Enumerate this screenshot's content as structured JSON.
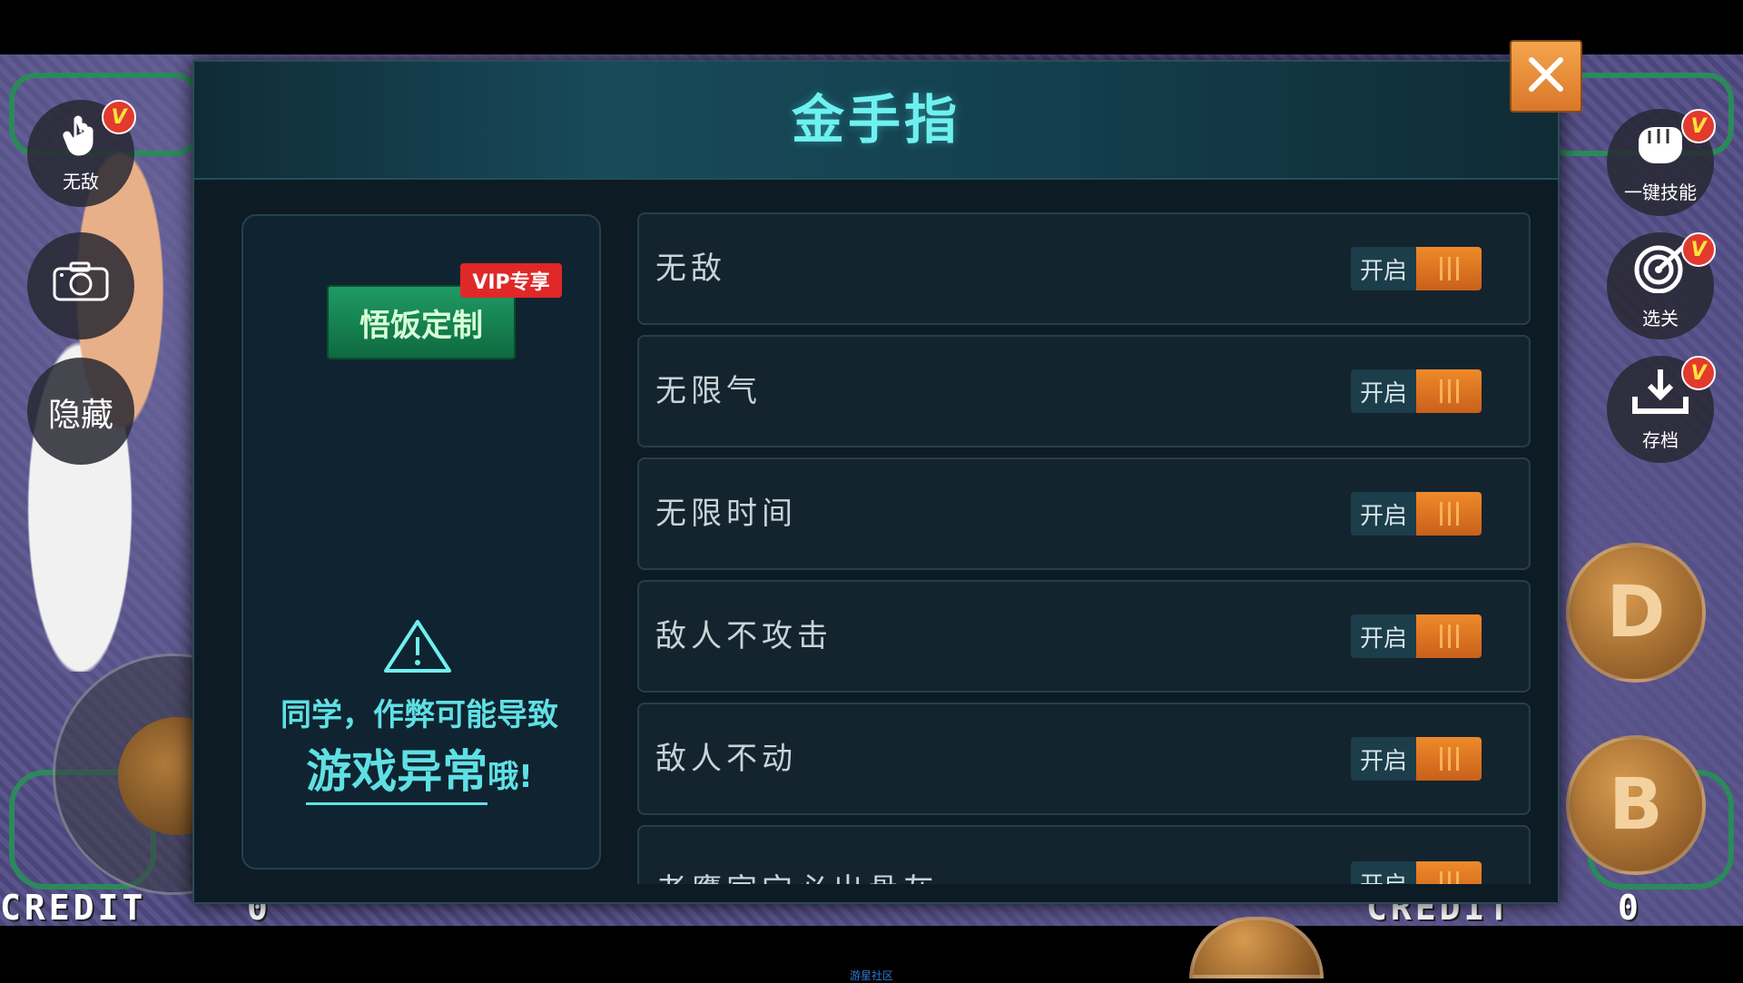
{
  "dialog": {
    "title": "金手指"
  },
  "left_buttons": {
    "invincible": {
      "label": "无敌",
      "icon": "hand-pointer-icon",
      "badge": "V"
    },
    "screenshot": {
      "icon": "camera-icon"
    },
    "hide": {
      "label": "隐藏"
    }
  },
  "right_buttons": {
    "skill": {
      "label": "一键技能",
      "icon": "fist-icon",
      "badge": "V"
    },
    "level": {
      "label": "选关",
      "icon": "target-icon",
      "badge": "V"
    },
    "save": {
      "label": "存档",
      "icon": "download-icon",
      "badge": "V"
    }
  },
  "action_buttons": {
    "d": "D",
    "b": "B"
  },
  "credits": {
    "left_label": "CREDIT",
    "left_value": "0",
    "right_label": "CREDIT",
    "right_value": "0"
  },
  "vip": {
    "button_label": "悟饭定制",
    "badge": "VIP专享"
  },
  "warning": {
    "line1": "同学，作弊可能导致",
    "emphasis": "游戏异常",
    "tail": "哦!"
  },
  "cheats": [
    {
      "name": "无敌",
      "toggle_label": "开启"
    },
    {
      "name": "无限气",
      "toggle_label": "开启"
    },
    {
      "name": "无限时间",
      "toggle_label": "开启"
    },
    {
      "name": "敌人不攻击",
      "toggle_label": "开启"
    },
    {
      "name": "敌人不动",
      "toggle_label": "开启"
    },
    {
      "name": "老鹰家宝必出骨灰",
      "toggle_label": "开启"
    }
  ],
  "watermark": "游星社区",
  "colors": {
    "accent": "#6ff0f0",
    "toggle_orange": "#e8822a",
    "close_orange": "#f0973d",
    "vip_red": "#e02828",
    "vip_green": "#178a56"
  }
}
